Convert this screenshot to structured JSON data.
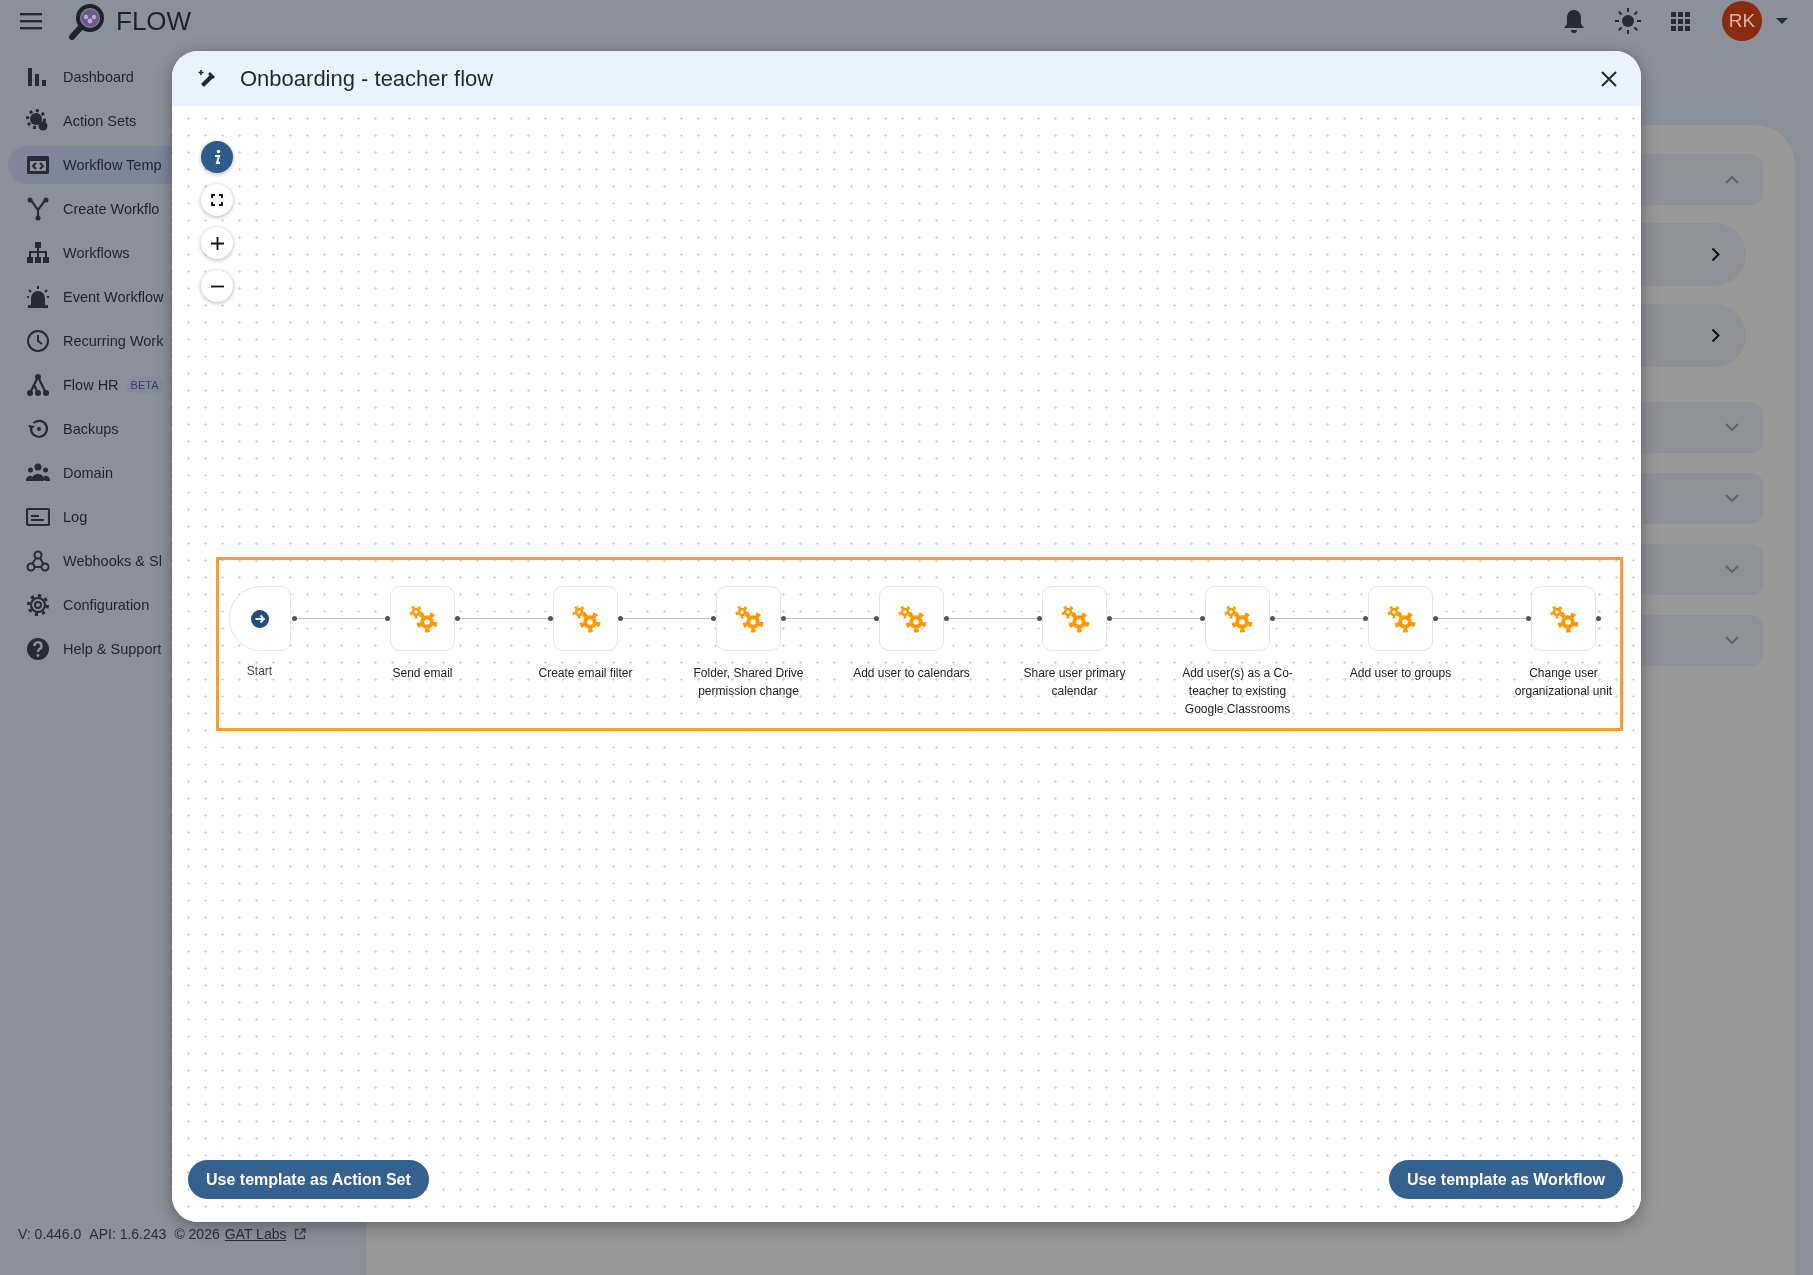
{
  "app": {
    "name": "FLOW",
    "avatar": "RK"
  },
  "sidebar": {
    "items": [
      {
        "label": "Dashboard",
        "selected": false
      },
      {
        "label": "Action Sets",
        "selected": false
      },
      {
        "label": "Workflow Temp",
        "selected": true
      },
      {
        "label": "Create Workflo",
        "selected": false
      },
      {
        "label": "Workflows",
        "selected": false
      },
      {
        "label": "Event Workflow",
        "selected": false
      },
      {
        "label": "Recurring Work",
        "selected": false
      },
      {
        "label": "Flow HR",
        "selected": false,
        "badge": "BETA"
      },
      {
        "label": "Backups",
        "selected": false
      },
      {
        "label": "Domain",
        "selected": false
      },
      {
        "label": "Log",
        "selected": false
      },
      {
        "label": "Webhooks & Sl",
        "selected": false
      },
      {
        "label": "Configuration",
        "selected": false
      },
      {
        "label": "Help & Support",
        "selected": false
      }
    ]
  },
  "background_rows": [
    {
      "kind": "accordion",
      "expanded": true
    },
    {
      "kind": "link"
    },
    {
      "kind": "link"
    },
    {
      "kind": "accordion",
      "expanded": false
    },
    {
      "kind": "accordion",
      "expanded": false
    },
    {
      "kind": "accordion",
      "expanded": false
    },
    {
      "kind": "accordion",
      "expanded": false
    }
  ],
  "footer": {
    "version": "V: 0.446.0",
    "api": "API: 1.6.243",
    "copyright": "© 2026",
    "link": "GAT Labs"
  },
  "modal": {
    "title": "Onboarding - teacher flow",
    "steps": [
      {
        "kind": "start",
        "label": "Start"
      },
      {
        "kind": "action",
        "label": "Send email"
      },
      {
        "kind": "action",
        "label": "Create email filter"
      },
      {
        "kind": "action",
        "label": "Folder, Shared Drive permission change"
      },
      {
        "kind": "action",
        "label": "Add user to calendars"
      },
      {
        "kind": "action",
        "label": "Share user primary calendar"
      },
      {
        "kind": "action",
        "label": "Add user(s) as a Co-teacher to existing Google Classrooms"
      },
      {
        "kind": "action",
        "label": "Add user to groups"
      },
      {
        "kind": "action",
        "label": "Change user organizational unit"
      }
    ],
    "buttons": [
      "Use template as Action Set",
      "Use template as Workflow"
    ]
  }
}
